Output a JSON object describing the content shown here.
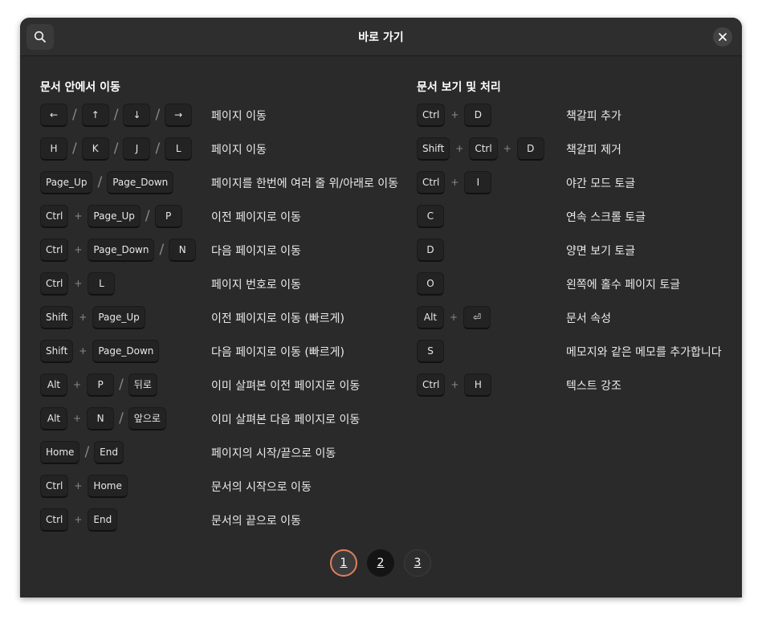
{
  "header": {
    "title": "바로 가기",
    "search_icon": "search-icon",
    "close_icon": "close-icon"
  },
  "left": {
    "title": "문서 안에서 이동",
    "rows": [
      {
        "keys": [
          "←",
          "/",
          "↑",
          "/",
          "↓",
          "/",
          "→"
        ],
        "desc": "페이지 이동"
      },
      {
        "keys": [
          "H",
          "/",
          "K",
          "/",
          "J",
          "/",
          "L"
        ],
        "desc": "페이지 이동"
      },
      {
        "keys": [
          "Page_Up",
          "/",
          "Page_Down"
        ],
        "desc": "페이지를 한번에 여러 줄 위/아래로 이동"
      },
      {
        "keys": [
          "Ctrl",
          "+",
          "Page_Up",
          "/",
          "P"
        ],
        "desc": "이전 페이지로 이동"
      },
      {
        "keys": [
          "Ctrl",
          "+",
          "Page_Down",
          "/",
          "N"
        ],
        "desc": "다음 페이지로 이동"
      },
      {
        "keys": [
          "Ctrl",
          "+",
          "L"
        ],
        "desc": "페이지 번호로 이동"
      },
      {
        "keys": [
          "Shift",
          "+",
          "Page_Up"
        ],
        "desc": "이전 페이지로 이동 (빠르게)"
      },
      {
        "keys": [
          "Shift",
          "+",
          "Page_Down"
        ],
        "desc": "다음 페이지로 이동 (빠르게)"
      },
      {
        "keys": [
          "Alt",
          "+",
          "P",
          "/",
          "뒤로"
        ],
        "desc": "이미 살펴본 이전 페이지로 이동"
      },
      {
        "keys": [
          "Alt",
          "+",
          "N",
          "/",
          "앞으로"
        ],
        "desc": "이미 살펴본 다음 페이지로 이동"
      },
      {
        "keys": [
          "Home",
          "/",
          "End"
        ],
        "desc": "페이지의 시작/끝으로 이동"
      },
      {
        "keys": [
          "Ctrl",
          "+",
          "Home"
        ],
        "desc": "문서의 시작으로 이동"
      },
      {
        "keys": [
          "Ctrl",
          "+",
          "End"
        ],
        "desc": "문서의 끝으로 이동"
      }
    ]
  },
  "right": {
    "title": "문서 보기 및 처리",
    "rows": [
      {
        "keys": [
          "Ctrl",
          "+",
          "D"
        ],
        "desc": "책갈피 추가"
      },
      {
        "keys": [
          "Shift",
          "+",
          "Ctrl",
          "+",
          "D"
        ],
        "desc": "책갈피 제거"
      },
      {
        "keys": [
          "Ctrl",
          "+",
          "I"
        ],
        "desc": "야간 모드 토글"
      },
      {
        "keys": [
          "C"
        ],
        "desc": "연속 스크롤 토글"
      },
      {
        "keys": [
          "D"
        ],
        "desc": "양면 보기 토글"
      },
      {
        "keys": [
          "O"
        ],
        "desc": "왼쪽에 홀수 페이지 토글"
      },
      {
        "keys": [
          "Alt",
          "+",
          "⏎"
        ],
        "desc": "문서 속성"
      },
      {
        "keys": [
          "S"
        ],
        "desc": "메모지와 같은 메모를 추가합니다"
      },
      {
        "keys": [
          "Ctrl",
          "+",
          "H"
        ],
        "desc": "텍스트 강조"
      }
    ]
  },
  "pagination": {
    "pages": [
      "1",
      "2",
      "3"
    ],
    "current": "1"
  },
  "colors": {
    "window_bg": "#2a2a2a",
    "key_bg": "#232323",
    "accent": "#e0805c"
  }
}
